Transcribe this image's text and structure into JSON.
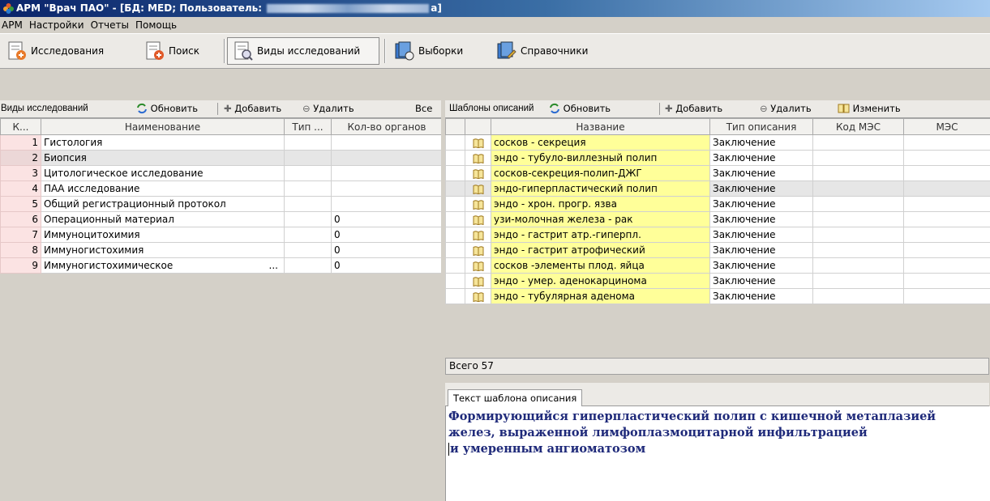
{
  "window": {
    "title_prefix": "АРМ \"Врач ПАО\" - [БД: MED;  Пользователь: ",
    "title_suffix": "а]"
  },
  "menu": [
    "АРМ",
    "Настройки",
    "Отчеты",
    "Помощь"
  ],
  "toolbar": {
    "buttons": [
      "Исследования",
      "Поиск",
      "Виды исследований",
      "Выборки",
      "Справочники"
    ],
    "active": "Виды исследований"
  },
  "left_panel": {
    "title": "Виды исследований",
    "refresh": "Обновить",
    "add": "Добавить",
    "delete": "Удалить",
    "all": "Все",
    "columns": [
      "К...",
      "Наименование",
      "Тип ...",
      "Кол-во органов"
    ],
    "rows": [
      {
        "num": "1",
        "name": "Гистология",
        "type": "",
        "count": ""
      },
      {
        "num": "2",
        "name": "Биопсия",
        "type": "",
        "count": ""
      },
      {
        "num": "3",
        "name": "Цитологическое исследование",
        "type": "",
        "count": ""
      },
      {
        "num": "4",
        "name": "ПАА исследование",
        "type": "",
        "count": ""
      },
      {
        "num": "5",
        "name": "Общий регистрационный протокол",
        "type": "",
        "count": ""
      },
      {
        "num": "6",
        "name": "Операционный материал",
        "type": "",
        "count": "0"
      },
      {
        "num": "7",
        "name": "Иммуноцитохимия",
        "type": "",
        "count": "0"
      },
      {
        "num": "8",
        "name": "Иммуногистохимия",
        "type": "",
        "count": "0"
      },
      {
        "num": "9",
        "name": "Иммуногистохимическое",
        "ellipsis": "...",
        "type": "",
        "count": "0"
      }
    ],
    "selected_row": 2
  },
  "right_panel": {
    "title": "Шаблоны описаний",
    "refresh": "Обновить",
    "add": "Добавить",
    "delete": "Удалить",
    "edit": "Изменить",
    "columns": [
      "",
      "",
      "Название",
      "Тип описания",
      "Код МЭС",
      "МЭС"
    ],
    "rows": [
      {
        "name": "сосков - секреция",
        "type": "Заключение"
      },
      {
        "name": "эндо - тубуло-виллезный полип",
        "type": "Заключение"
      },
      {
        "name": "сосков-секреция-полип-ДЖГ",
        "type": "Заключение"
      },
      {
        "name": "эндо-гиперпластический полип",
        "type": "Заключение"
      },
      {
        "name": "эндо - хрон. прогр. язва",
        "type": "Заключение"
      },
      {
        "name": "узи-молочная железа - рак",
        "type": "Заключение"
      },
      {
        "name": "эндо - гастрит атр.-гиперпл.",
        "type": "Заключение"
      },
      {
        "name": "эндо - гастрит атрофический",
        "type": "Заключение"
      },
      {
        "name": "сосков -элементы плод. яйца",
        "type": "Заключение"
      },
      {
        "name": "эндо - умер. аденокарцинома",
        "type": "Заключение"
      },
      {
        "name": "эндо - тубулярная аденома",
        "type": "Заключение"
      }
    ],
    "selected_row": 4,
    "total": "Всего 57"
  },
  "description": {
    "tab": "Текст шаблона описания",
    "lines": [
      "Формирующийся гиперпластический полип с кишечной метаплазией",
      "желез, выраженной лимфоплазмоцитарной инфильтрацией",
      "и умеренным ангиоматозом"
    ]
  },
  "colors": {
    "highlight_name": "#ffff99",
    "row_number_bg": "#fbe3e3",
    "description_text": "#1f2a7a"
  }
}
